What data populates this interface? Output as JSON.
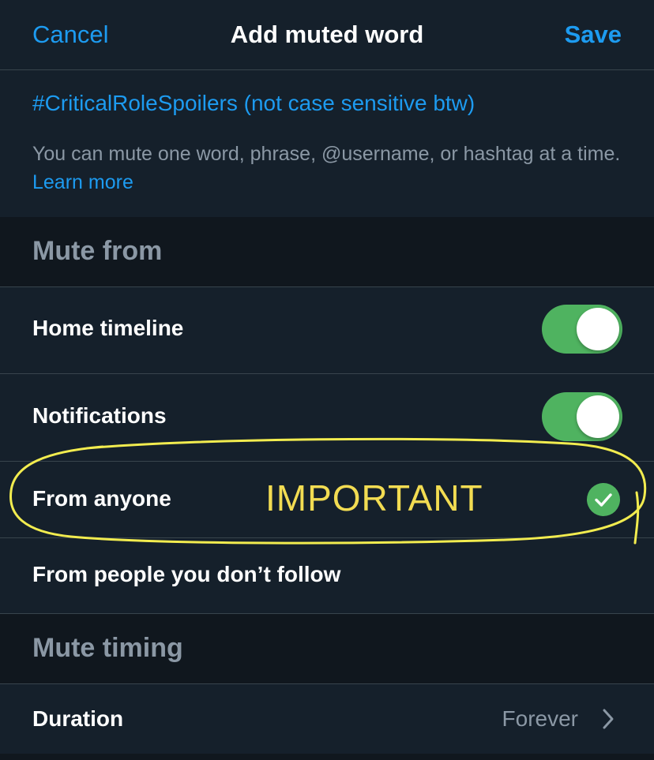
{
  "navbar": {
    "cancel_label": "Cancel",
    "title": "Add muted word",
    "save_label": "Save"
  },
  "word_input": {
    "value": "#CriticalRoleSpoilers (not case sensitive btw)"
  },
  "help": {
    "text": "You can mute one word, phrase, @username, or hashtag at a time.",
    "link_label": "Learn more"
  },
  "mute_from": {
    "header": "Mute from",
    "home_timeline": {
      "label": "Home timeline",
      "enabled": true
    },
    "notifications": {
      "label": "Notifications",
      "enabled": true
    },
    "options": [
      {
        "label": "From anyone",
        "selected": true
      },
      {
        "label": "From people you don’t follow",
        "selected": false
      }
    ]
  },
  "annotation": {
    "text": "IMPORTANT",
    "color": "#f2dc52"
  },
  "mute_timing": {
    "header": "Mute timing",
    "duration_label": "Duration",
    "duration_value": "Forever"
  },
  "colors": {
    "background": "#15202b",
    "section_background": "#10171e",
    "accent_blue": "#1d9bf0",
    "toggle_green": "#4fb360",
    "secondary_text": "#8b98a5",
    "divider": "#38444d"
  },
  "icons": {
    "check": "check-circle-icon",
    "chevron": "chevron-right-icon"
  }
}
